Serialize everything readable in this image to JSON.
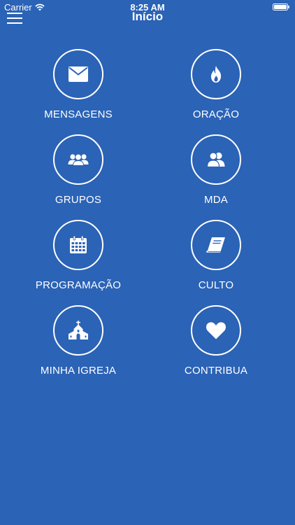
{
  "status_bar": {
    "carrier": "Carrier",
    "time": "8:25 AM"
  },
  "nav": {
    "title": "Início"
  },
  "menu": {
    "items": [
      {
        "label": "MENSAGENS",
        "icon": "envelope-icon"
      },
      {
        "label": "ORAÇÃO",
        "icon": "flame-icon"
      },
      {
        "label": "GRUPOS",
        "icon": "group-icon"
      },
      {
        "label": "MDA",
        "icon": "users-icon"
      },
      {
        "label": "PROGRAMAÇÃO",
        "icon": "calendar-icon"
      },
      {
        "label": "CULTO",
        "icon": "book-icon"
      },
      {
        "label": "MINHA IGREJA",
        "icon": "church-icon"
      },
      {
        "label": "CONTRIBUA",
        "icon": "heart-icon"
      }
    ]
  },
  "colors": {
    "background": "#2b63b6",
    "foreground": "#ffffff"
  }
}
